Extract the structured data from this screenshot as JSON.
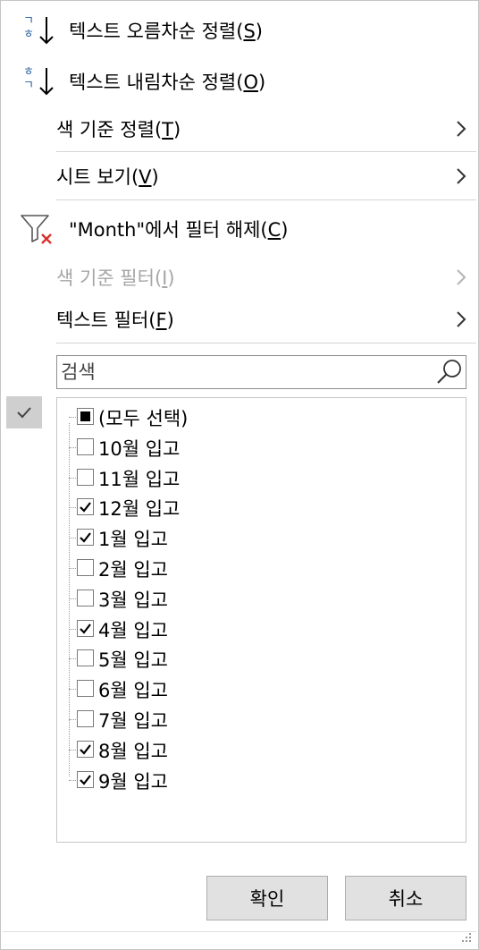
{
  "menu": {
    "sort_asc": {
      "label": "텍스트 오름차순 정렬",
      "key": "S",
      "icon_letters": [
        "ㄱ",
        "ㅎ"
      ]
    },
    "sort_desc": {
      "label": "텍스트 내림차순 정렬",
      "key": "O",
      "icon_letters": [
        "ㅎ",
        "ㄱ"
      ]
    },
    "sort_by_color": {
      "label": "색 기준 정렬",
      "key": "T"
    },
    "sheet_view": {
      "label": "시트 보기",
      "key": "V"
    },
    "clear_filter": {
      "label": "\"Month\"에서 필터 해제",
      "key": "C"
    },
    "filter_by_color": {
      "label": "색 기준 필터",
      "key": "I",
      "disabled": true
    },
    "text_filter": {
      "label": "텍스트 필터",
      "key": "F"
    }
  },
  "search": {
    "placeholder": "검색",
    "value": ""
  },
  "list": {
    "items": [
      {
        "label": "(모두 선택)",
        "state": "mixed"
      },
      {
        "label": "10월 입고",
        "state": "unchecked"
      },
      {
        "label": "11월 입고",
        "state": "unchecked"
      },
      {
        "label": "12월 입고",
        "state": "checked"
      },
      {
        "label": "1월 입고",
        "state": "checked"
      },
      {
        "label": "2월 입고",
        "state": "unchecked"
      },
      {
        "label": "3월 입고",
        "state": "unchecked"
      },
      {
        "label": "4월 입고",
        "state": "checked"
      },
      {
        "label": "5월 입고",
        "state": "unchecked"
      },
      {
        "label": "6월 입고",
        "state": "unchecked"
      },
      {
        "label": "7월 입고",
        "state": "unchecked"
      },
      {
        "label": "8월 입고",
        "state": "checked"
      },
      {
        "label": "9월 입고",
        "state": "checked"
      }
    ]
  },
  "buttons": {
    "ok": "확인",
    "cancel": "취소"
  },
  "colors": {
    "icon_blue": "#1f5c9e",
    "clear_x_red": "#d9312b",
    "disabled_text": "#a6a6a6"
  }
}
